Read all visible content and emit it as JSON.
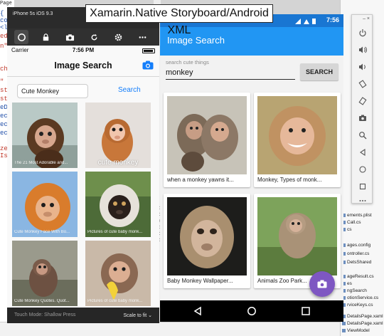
{
  "overlay_title": "Xamarin.Native Storyboard/Android XML",
  "ide": {
    "page_label": "Page",
    "code_fragments": [
      {
        "text": "{",
        "style": "b"
      },
      {
        "text": "co",
        "style": "b"
      },
      {
        "text": "<l",
        "style": "b"
      },
      {
        "text": "ed",
        "style": "r"
      },
      {
        "text": "n\"",
        "style": "r"
      },
      {
        "text": "ch",
        "style": "r"
      },
      {
        "text": "\"",
        "style": "r"
      },
      {
        "text": "st",
        "style": "r"
      },
      {
        "text": "st",
        "style": "r"
      },
      {
        "text": "eD",
        "style": "b"
      },
      {
        "text": "ec",
        "style": "b"
      },
      {
        "text": "ec",
        "style": "b"
      },
      {
        "text": "ec",
        "style": "b"
      },
      {
        "text": "ze",
        "style": "r"
      },
      {
        "text": "Is",
        "style": "r"
      }
    ],
    "mid_fragments": [
      "0.1",
      "0.1",
      "syst",
      "0.1",
      "0.1",
      "0.1"
    ]
  },
  "explorer": {
    "items": [
      {
        "label": "ements.plist",
        "selected": false
      },
      {
        "label": "Call.cs",
        "selected": false
      },
      {
        "label": "cs",
        "selected": false
      },
      {
        "label": "ages.config",
        "selected": false
      },
      {
        "label": "ontroller.cs",
        "selected": false
      },
      {
        "label": "DetsShared",
        "selected": false
      },
      {
        "label": "ageResult.cs",
        "selected": false
      },
      {
        "label": "es",
        "selected": false
      },
      {
        "label": "ngSearch",
        "selected": false
      },
      {
        "label": "otionService.cs",
        "selected": false
      },
      {
        "label": "rviceKeys.cs",
        "selected": false
      },
      {
        "label": "DetailsPage.xaml",
        "selected": false
      },
      {
        "label": "DetailsPage.xaml",
        "selected": false
      },
      {
        "label": "ViewModel",
        "selected": false
      }
    ]
  },
  "ios": {
    "device_title": "iPhone 5s iOS 9.3",
    "status": {
      "carrier": "Carrier",
      "time": "7:56 PM"
    },
    "nav_title": "Image Search",
    "search_value": "Cute Monkey",
    "search_button": "Search",
    "results": [
      {
        "caption": "The 21 Most Adorable and...",
        "big": false
      },
      {
        "caption": "cute monkey",
        "big": true
      },
      {
        "caption": "Cute Monkey Face With Bo...",
        "big": false
      },
      {
        "caption": "Pictures of cute baby monk...",
        "big": false
      },
      {
        "caption": "Cute Monkey Quotes. Quot...",
        "big": false
      },
      {
        "caption": "Pictures of cute baby monk...",
        "big": false
      }
    ],
    "bottom": {
      "touch_mode": "Touch Mode:  Shallow Press",
      "scale": "Scale to fit ⌄"
    }
  },
  "android": {
    "status_time": "7:56",
    "toolbar_title": "Image Search",
    "search_hint": "search cute things",
    "search_value": "monkey",
    "search_button": "SEARCH",
    "results": [
      {
        "caption": "when a monkey yawns it..."
      },
      {
        "caption": "Monkey, Types of monk..."
      },
      {
        "caption": "Baby Monkey Wallpaper..."
      },
      {
        "caption": "Animals Zoo Park..."
      }
    ]
  },
  "colors": {
    "android_primary": "#2196f3",
    "android_primary_dark": "#1976d2",
    "android_fab": "#7e57c2",
    "ios_tint": "#147efb"
  }
}
